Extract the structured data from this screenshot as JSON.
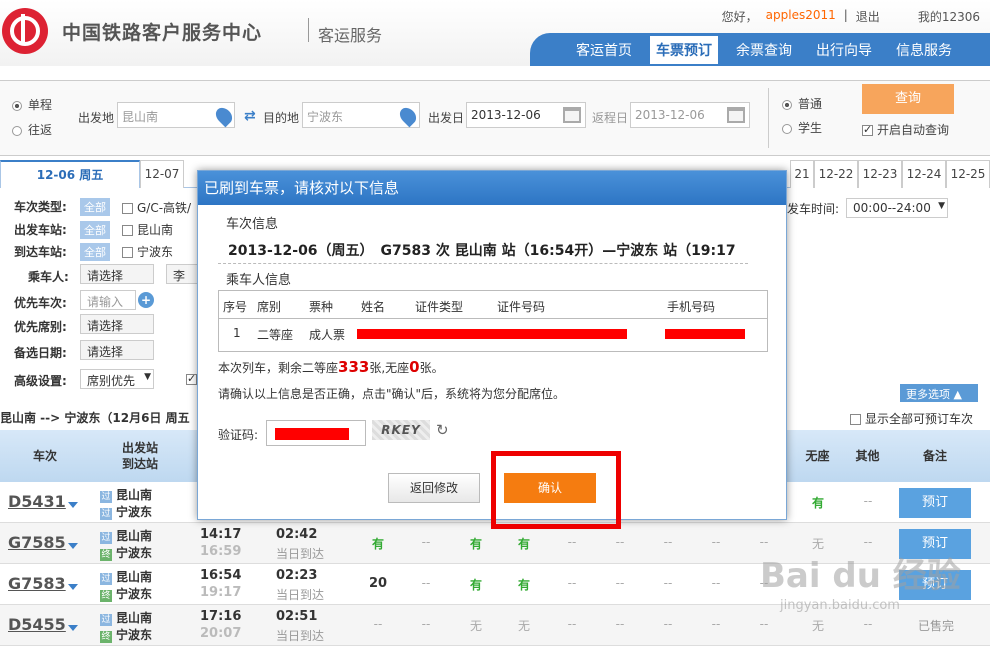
{
  "header": {
    "title": "中国铁路客户服务中心",
    "subtitle": "客运服务",
    "greeting": "您好，",
    "username": "apples2011",
    "divider": "|",
    "logout": "退出",
    "my_account": "我的12306",
    "nav": [
      "客运首页",
      "车票预订",
      "余票查询",
      "出行向导",
      "信息服务"
    ]
  },
  "query": {
    "trip_one_way": "单程",
    "trip_round": "往返",
    "from_label": "出发地",
    "from_value": "昆山南",
    "to_label": "目的地",
    "to_value": "宁波东",
    "date_label": "出发日",
    "date_value": "2013-12-06",
    "return_label": "返程日",
    "return_value": "2013-12-06",
    "ticket_normal": "普通",
    "ticket_student": "学生",
    "query_button": "查询",
    "auto_query": "开启自动查询"
  },
  "date_tabs": [
    "12-06 周五",
    "12-07",
    "21",
    "12-22",
    "12-23",
    "12-24",
    "12-25"
  ],
  "filters": {
    "train_type": "车次类型:",
    "depart_station": "出发车站:",
    "arrive_station": "到达车站:",
    "all_tag": "全部",
    "train_type_opt": "G/C-高铁/",
    "depart_opt": "昆山南",
    "arrive_opt": "宁波东",
    "passenger": "乘车人:",
    "passenger_select": "请选择",
    "passenger_name": "李莲",
    "priority_train": "优先车次:",
    "priority_train_input": "请输入",
    "priority_seat": "优先席别:",
    "seat_select": "请选择",
    "alt_date": "备选日期:",
    "alt_date_select": "请选择",
    "advanced": "高级设置:",
    "advanced_value": "席别优先",
    "depart_time_label": "发车时间:",
    "depart_time_value": "00:00--24:00",
    "more_options": "更多选项",
    "show_all": "显示全部可预订车次"
  },
  "summary": "昆山南 --> 宁波东（12月6日 周五",
  "table": {
    "headers": [
      "车次",
      "出发站\n到达站",
      "无座",
      "其他",
      "备注"
    ],
    "rows": [
      {
        "train": "D5431",
        "from": "昆山南",
        "to": "宁波东",
        "dep": "",
        "arr": "",
        "dur": "",
        "dur2": "",
        "c1": "",
        "c2": "",
        "c3": "",
        "nos": "有",
        "other": "--",
        "action": "预订"
      },
      {
        "train": "G7585",
        "from": "昆山南",
        "to": "宁波东",
        "dep": "14:17",
        "arr": "16:59",
        "dur": "02:42",
        "dur2": "当日到达",
        "c1": "有",
        "c2": "--",
        "c3": "有",
        "c4": "有",
        "nos": "无",
        "other": "--",
        "action": "预订"
      },
      {
        "train": "G7583",
        "from": "昆山南",
        "to": "宁波东",
        "dep": "16:54",
        "arr": "19:17",
        "dur": "02:23",
        "dur2": "当日到达",
        "c1": "20",
        "c2": "--",
        "c3": "有",
        "c4": "有",
        "nos": "",
        "other": "",
        "action": "预订"
      },
      {
        "train": "D5455",
        "from": "昆山南",
        "to": "宁波东",
        "dep": "17:16",
        "arr": "20:07",
        "dur": "02:51",
        "dur2": "当日到达",
        "c1": "--",
        "c2": "--",
        "c3": "无",
        "c4": "无",
        "nos": "无",
        "other": "--",
        "action": "已售完"
      }
    ]
  },
  "dialog": {
    "title": "已刷到车票，请核对以下信息",
    "train_info_heading": "车次信息",
    "train_info": "2013-12-06（周五）　G7583 次 昆山南 站（16:54开）—宁波东 站（19:17",
    "passenger_heading": "乘车人信息",
    "cols": [
      "序号",
      "席别",
      "票种",
      "姓名",
      "证件类型",
      "证件号码",
      "手机号码"
    ],
    "row": {
      "no": "1",
      "seat": "二等座",
      "type": "成人票"
    },
    "remain_prefix": "本次列车，剩余二等座",
    "remain_count": "333",
    "remain_mid": "张,无座",
    "remain_noseat": "0",
    "remain_suffix": "张。",
    "notice": "请确认以上信息是否正确，点击\"确认\"后，系统将为您分配席位。",
    "captcha_label": "验证码:",
    "captcha_text": "RKEY",
    "back_button": "返回修改",
    "confirm_button": "确认"
  },
  "watermark": {
    "brand": "Bai du 经验",
    "url": "jingyan.baidu.com"
  }
}
